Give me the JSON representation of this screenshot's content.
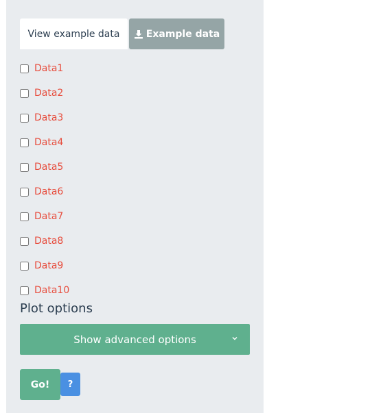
{
  "buttons": {
    "view_example": "View example data",
    "download_example": "Example data",
    "go": "Go!",
    "help": "?"
  },
  "datasets": [
    {
      "label": "Data1",
      "checked": false
    },
    {
      "label": "Data2",
      "checked": false
    },
    {
      "label": "Data3",
      "checked": false
    },
    {
      "label": "Data4",
      "checked": false
    },
    {
      "label": "Data5",
      "checked": false
    },
    {
      "label": "Data6",
      "checked": false
    },
    {
      "label": "Data7",
      "checked": false
    },
    {
      "label": "Data8",
      "checked": false
    },
    {
      "label": "Data9",
      "checked": false
    },
    {
      "label": "Data10",
      "checked": false
    }
  ],
  "plot_options": {
    "title": "Plot options",
    "advanced_label": "Show advanced options"
  },
  "icons": {
    "download": "download-icon",
    "chevron": "chevron-down-icon"
  },
  "colors": {
    "panel_bg": "#e9ecef",
    "label_red": "#e74c3c",
    "accent_green": "#5fb08e",
    "gray_button": "#95a5a6",
    "help_blue": "#4a90e2",
    "text_dark": "#2c3e50"
  }
}
